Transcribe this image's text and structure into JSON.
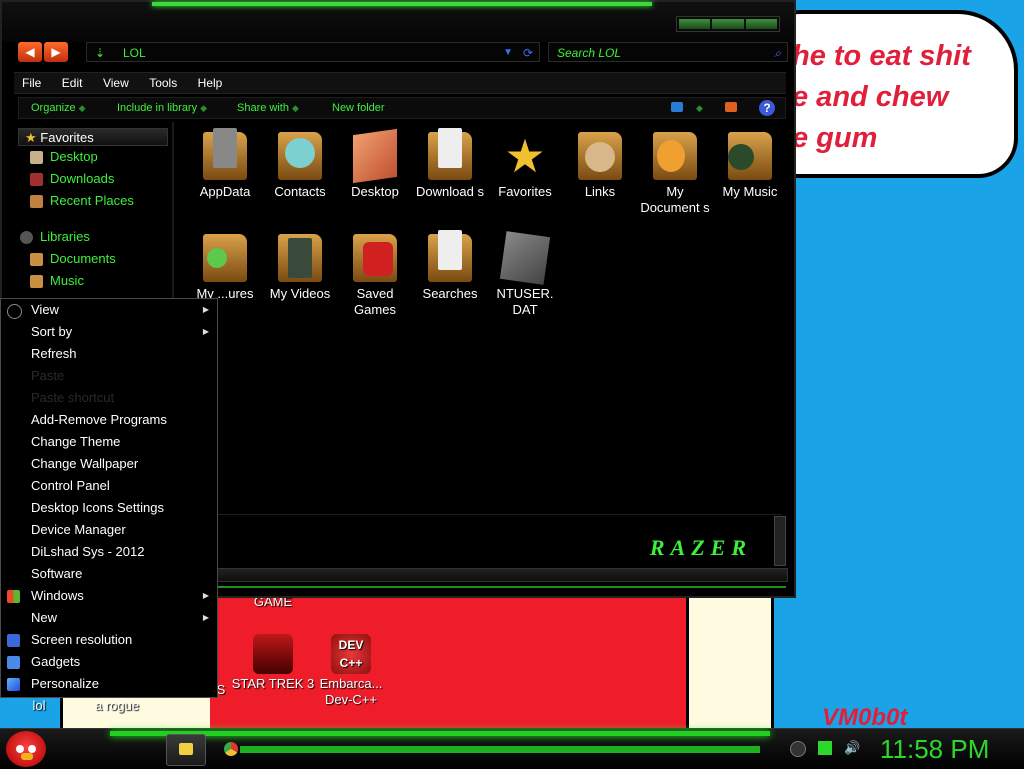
{
  "wallpaper": {
    "bubble_text": "he to eat shit\ne and chew\ne gum",
    "signature": "VM0b0t"
  },
  "desktop_icons": [
    {
      "label": "GAME"
    },
    {
      "label": "lol"
    },
    {
      "label": "a rogue"
    },
    {
      "label": "S"
    },
    {
      "label": "STAR TREK 3"
    },
    {
      "label": "Embarca... Dev-C++"
    }
  ],
  "explorer": {
    "address": "LOL",
    "search_placeholder": "Search LOL",
    "menu": [
      "File",
      "Edit",
      "View",
      "Tools",
      "Help"
    ],
    "toolbar": {
      "organize": "Organize",
      "include": "Include in library",
      "share": "Share with",
      "new_folder": "New folder"
    },
    "nav": {
      "favorites_header": "Favorites",
      "favorites": [
        "Desktop",
        "Downloads",
        "Recent Places"
      ],
      "libraries_header": "Libraries",
      "libraries": [
        "Documents",
        "Music"
      ]
    },
    "files": [
      {
        "name": "AppData"
      },
      {
        "name": "Contacts"
      },
      {
        "name": "Desktop"
      },
      {
        "name": "Download s"
      },
      {
        "name": "Favorites"
      },
      {
        "name": "Links"
      },
      {
        "name": "My Document s"
      },
      {
        "name": "My Music"
      },
      {
        "name": "My ...ures"
      },
      {
        "name": "My Videos"
      },
      {
        "name": "Saved Games"
      },
      {
        "name": "Searches"
      },
      {
        "name": "NTUSER. DAT"
      }
    ],
    "brand": "RAZER"
  },
  "context_menu": [
    {
      "label": "View",
      "sub": true
    },
    {
      "label": "Sort by",
      "sub": true
    },
    {
      "label": "Refresh"
    },
    {
      "label": "Paste",
      "disabled": true
    },
    {
      "label": "Paste shortcut",
      "disabled": true
    },
    {
      "label": "Add-Remove Programs"
    },
    {
      "label": "Change Theme"
    },
    {
      "label": "Change Wallpaper"
    },
    {
      "label": "Control Panel"
    },
    {
      "label": "Desktop Icons Settings"
    },
    {
      "label": "Device Manager"
    },
    {
      "label": "DiLshad Sys - 2012"
    },
    {
      "label": "Software"
    },
    {
      "label": "Windows",
      "sub": true
    },
    {
      "label": "New",
      "sub": true
    },
    {
      "label": "Screen resolution"
    },
    {
      "label": "Gadgets"
    },
    {
      "label": "Personalize"
    }
  ],
  "taskbar": {
    "clock": "11:58 PM"
  },
  "colors": {
    "accent_green": "#3cf03c",
    "desktop_blue": "#1aa3e6",
    "wall_red": "#ef1c2a"
  }
}
